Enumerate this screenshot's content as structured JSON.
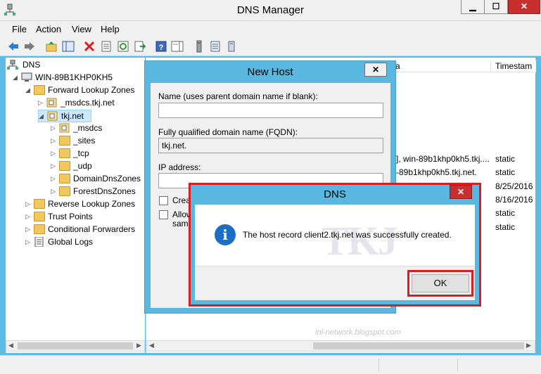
{
  "window": {
    "title": "DNS Manager"
  },
  "window_controls": {
    "minimize": "▁",
    "maximize": "☐",
    "close": "✕"
  },
  "menu": [
    "File",
    "Action",
    "View",
    "Help"
  ],
  "toolbar_icons": [
    "back-arrow-icon",
    "forward-arrow-icon",
    "up-folder-icon",
    "show-hide-console-tree-icon",
    "delete-icon",
    "properties-icon",
    "refresh-icon",
    "export-list-icon",
    "help-icon",
    "action-pane-icon",
    "server-icon",
    "file-list-icon",
    "device-icon"
  ],
  "tree": {
    "root": "DNS",
    "server": "WIN-89B1KHP0KH5",
    "forward": "Forward Lookup Zones",
    "msdcs_zone": "_msdcs.tkj.net",
    "tkj_zone": "tkj.net",
    "children": [
      "_msdcs",
      "_sites",
      "_tcp",
      "_udp",
      "DomainDnsZones",
      "ForestDnsZones"
    ],
    "reverse": "Reverse Lookup Zones",
    "trust": "Trust Points",
    "conditional": "Conditional Forwarders",
    "global_logs": "Global Logs"
  },
  "list": {
    "col_data_partial": "a",
    "col_timestamp": "Timestam",
    "rows": [
      {
        "data": "], win-89b1khp0kh5.tkj....",
        "ts": "static"
      },
      {
        "data": "-89b1khp0kh5.tkj.net.",
        "ts": "static"
      },
      {
        "data": "",
        "ts": "8/25/2016"
      },
      {
        "data": "",
        "ts": "8/16/2016"
      },
      {
        "data": "",
        "ts": "static"
      },
      {
        "data": "",
        "ts": "static"
      }
    ]
  },
  "new_host": {
    "title": "New Host",
    "close": "✕",
    "name_label": "Name (uses parent domain name if blank):",
    "name_value": "",
    "fqdn_label": "Fully qualified domain name (FQDN):",
    "fqdn_value": "tkj.net.",
    "ip_label": "IP address:",
    "ip_value": "",
    "create_ptr_label": "Creat",
    "allow_label": "Allow",
    "allow_label2": "same"
  },
  "dns_dialog": {
    "title": "DNS",
    "close": "✕",
    "message": "The host record client2.tkj.net was successfully created.",
    "info_glyph": "i",
    "ok_label": "OK",
    "watermark": "TKJ",
    "watermark_url": "lnl-network.blogspot.com"
  },
  "colors": {
    "accent": "#5ab7e0",
    "highlight_red": "#d42020",
    "close_red": "#c7302f"
  }
}
